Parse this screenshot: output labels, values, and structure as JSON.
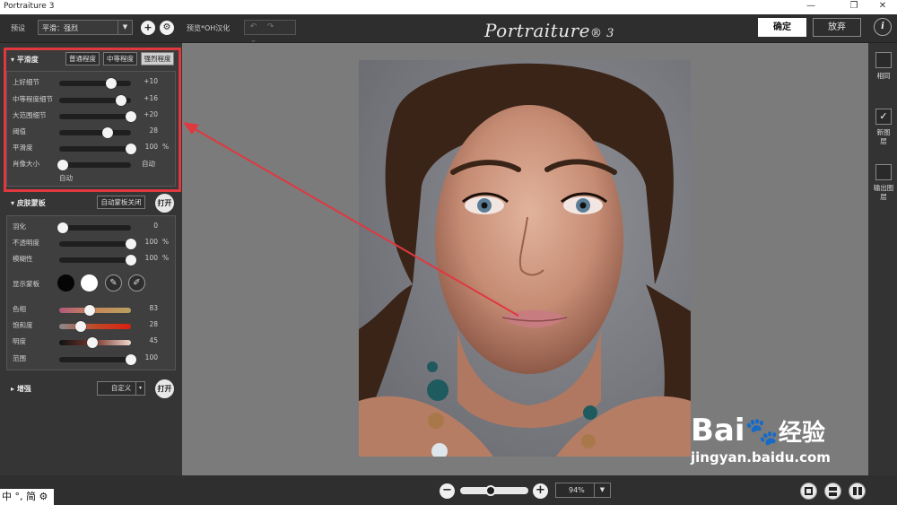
{
  "window": {
    "title": "Portraiture 3",
    "min_icon": "minimize-icon",
    "restore_icon": "restore-icon",
    "close_icon": "close-icon"
  },
  "toolbar": {
    "preset_label": "预设",
    "preset_value": "平滑：强烈",
    "preview_label": "预览*OH汉化",
    "logo_text": "Portraiture",
    "logo_suffix": "® 3",
    "ok_label": "确定",
    "cancel_label": "放弃",
    "info_label": "i"
  },
  "smoothing": {
    "title": "平滑度",
    "buttons": [
      "普通程度",
      "中等程度",
      "强烈程度"
    ],
    "active_button": "强烈程度",
    "rows": [
      {
        "label": "上好细节",
        "value": "+10",
        "unit": "",
        "fraction": 0.72
      },
      {
        "label": "中等程度细节",
        "value": "+16",
        "unit": "",
        "fraction": 0.86
      },
      {
        "label": "大范围细节",
        "value": "+20",
        "unit": "",
        "fraction": 1.0
      },
      {
        "label": "阈值",
        "value": "28",
        "unit": "",
        "fraction": 0.68
      },
      {
        "label": "平滑度",
        "value": "100",
        "unit": "%",
        "fraction": 1.0
      },
      {
        "label": "肖像大小",
        "value": "自动",
        "unit": "",
        "fraction": 0.05
      }
    ],
    "footer": "自动"
  },
  "skin_mask": {
    "title": "皮肤蒙板",
    "auto_button": "自动蒙板关闭",
    "open_button": "打开",
    "rows": [
      {
        "label": "羽化",
        "value": "0",
        "unit": "",
        "fraction": 0.05
      },
      {
        "label": "不透明度",
        "value": "100",
        "unit": "%",
        "fraction": 1.0
      },
      {
        "label": "模糊性",
        "value": "100",
        "unit": "%",
        "fraction": 1.0
      }
    ],
    "show_mask_label": "显示蒙板",
    "color_rows": [
      {
        "label": "色相",
        "value": "83",
        "fraction": 0.43
      },
      {
        "label": "饱和度",
        "value": "28",
        "fraction": 0.3
      },
      {
        "label": "明度",
        "value": "45",
        "fraction": 0.46
      },
      {
        "label": "范围",
        "value": "100",
        "fraction": 1.0
      }
    ]
  },
  "enhance": {
    "title": "增强",
    "custom_button": "自定义",
    "open_button": "打开"
  },
  "right_panel": {
    "items": [
      {
        "label": "相同",
        "checked": false
      },
      {
        "label": "新图层",
        "checked": true
      },
      {
        "label": "输出图层",
        "checked": false
      }
    ]
  },
  "bottom": {
    "zoom_value": "94%",
    "zoom_fraction": 0.45
  },
  "ime": {
    "text": "中 °, 简"
  },
  "watermark": {
    "line1": "Bai",
    "line2": "经验",
    "url": "jingyan.baidu.com"
  },
  "colors": {
    "highlight": "#e0383f",
    "accent": "#ffffff",
    "panel": "#353535",
    "canvas": "#7b7b7b"
  }
}
